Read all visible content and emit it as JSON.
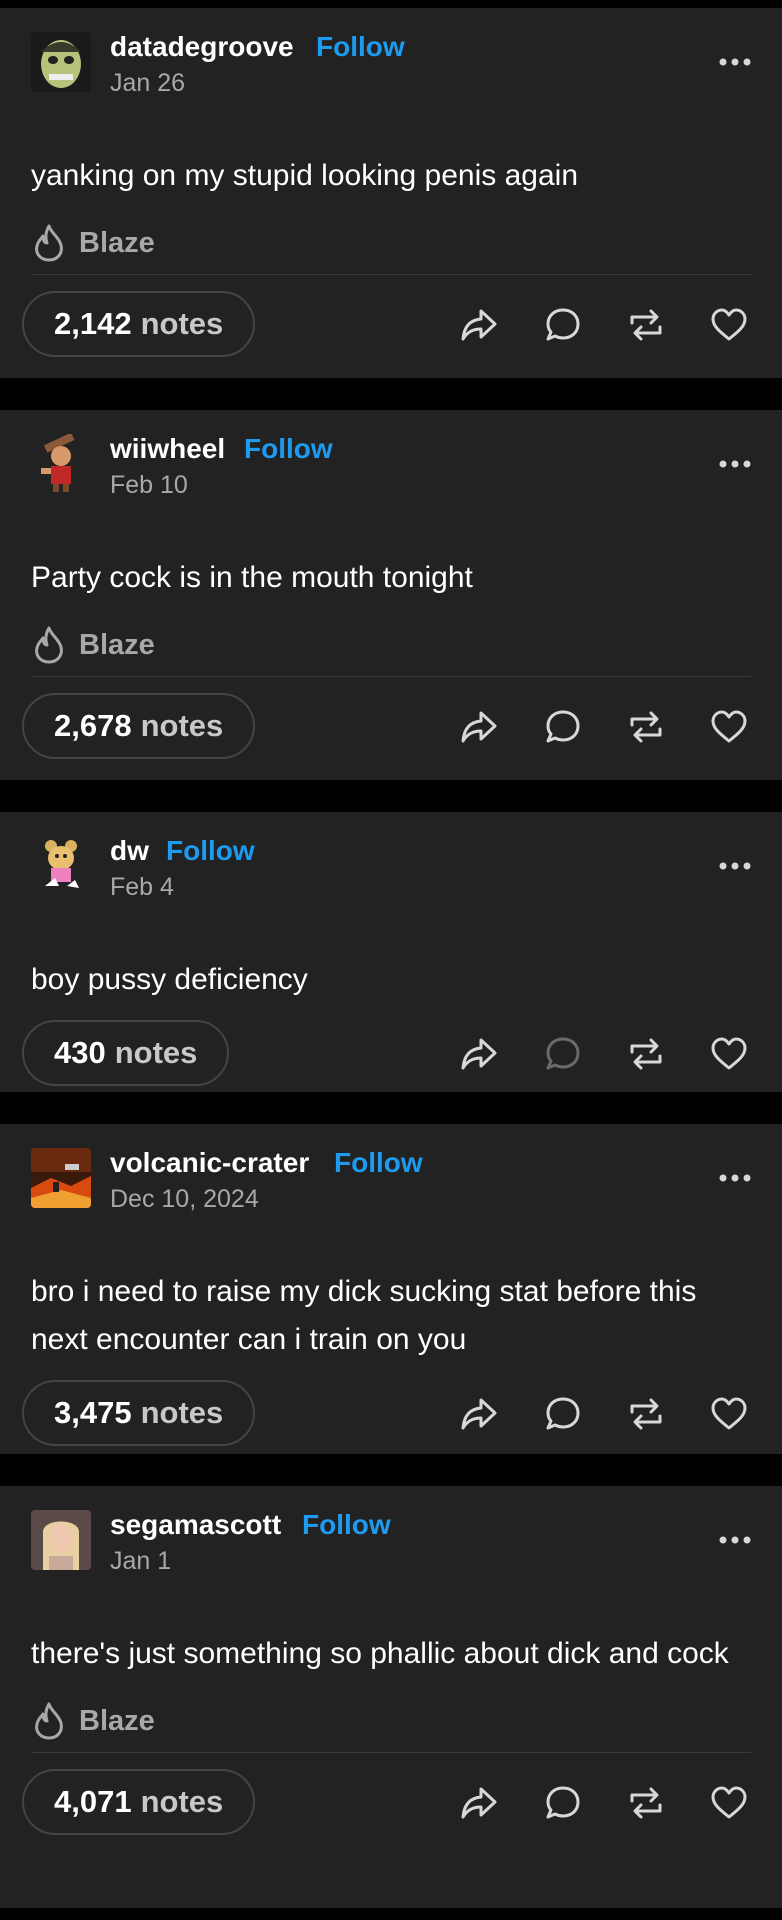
{
  "posts": [
    {
      "username": "datadegroove",
      "follow_label": "Follow",
      "date": "Jan 26",
      "text": "yanking on my stupid looking penis again",
      "blaze_label": "Blaze",
      "notes_count": "2,142",
      "notes_label": "notes"
    },
    {
      "username": "wiiwheel",
      "follow_label": "Follow",
      "date": "Feb 10",
      "text": "Party cock is in the mouth tonight",
      "blaze_label": "Blaze",
      "notes_count": "2,678",
      "notes_label": "notes"
    },
    {
      "username": "dw",
      "follow_label": "Follow",
      "date": "Feb 4",
      "text": "boy pussy deficiency",
      "notes_count": "430",
      "notes_label": "notes"
    },
    {
      "username": "volcanic-crater",
      "follow_label": "Follow",
      "date": "Dec 10, 2024",
      "text": "bro i need to raise my dick sucking stat before this next encounter can i train on you",
      "notes_count": "3,475",
      "notes_label": "notes"
    },
    {
      "username": "segamascott",
      "follow_label": "Follow",
      "date": "Jan 1",
      "text": "there's just something so phallic about dick and cock",
      "blaze_label": "Blaze",
      "notes_count": "4,071",
      "notes_label": "notes"
    }
  ],
  "icons": {
    "more": "more-options-icon",
    "blaze": "flame-icon",
    "share": "share-arrow-icon",
    "reply": "speech-bubble-icon",
    "reblog": "reblog-icon",
    "like": "heart-icon"
  },
  "colors": {
    "background": "#000000",
    "card": "#222222",
    "follow": "#1d9bf0",
    "muted": "#a8a8a8"
  }
}
